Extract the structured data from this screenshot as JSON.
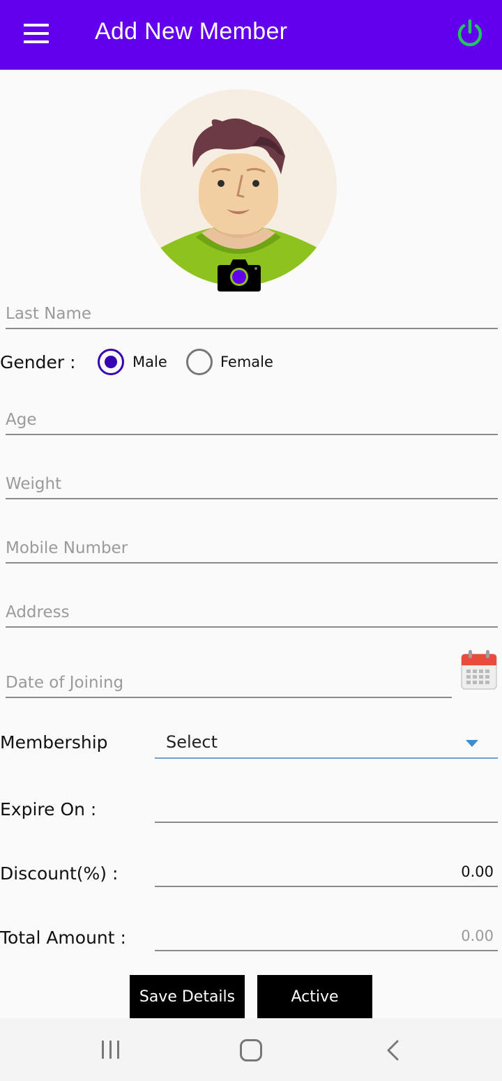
{
  "app_bar": {
    "title": "Add New Member"
  },
  "form": {
    "last_name_placeholder": "Last Name",
    "gender": {
      "label": "Gender :",
      "options": [
        "Male",
        "Female"
      ],
      "selected": "Male"
    },
    "age_placeholder": "Age",
    "weight_placeholder": "Weight",
    "mobile_placeholder": "Mobile Number",
    "address_placeholder": "Address",
    "doj_placeholder": "Date of Joining",
    "membership": {
      "label": "Membership",
      "selected": "Select"
    },
    "expire_label": "Expire On :",
    "expire_value": "",
    "discount": {
      "label": "Discount(%) :",
      "value": "0.00"
    },
    "total": {
      "label": "Total Amount :",
      "value": "0.00"
    }
  },
  "buttons": {
    "save": "Save Details",
    "active": "Active"
  },
  "icons": {
    "menu": "hamburger-menu-icon",
    "power": "power-icon",
    "camera": "camera-icon",
    "calendar": "calendar-icon"
  },
  "colors": {
    "primary": "#6200ee",
    "power": "#22c55e",
    "radio": "#3700b3",
    "button": "#000000"
  }
}
